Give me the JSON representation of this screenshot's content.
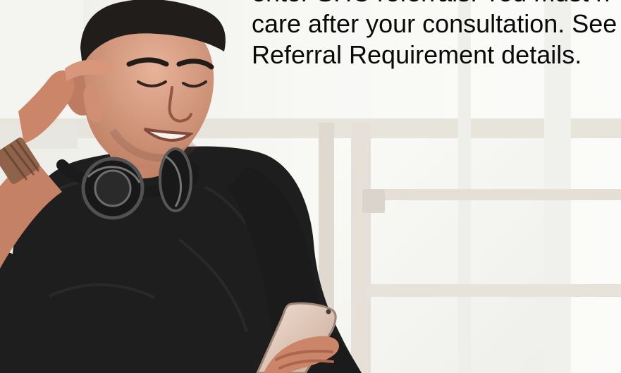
{
  "hero": {
    "caption_lines": [
      "enter SHC referrals. You must h",
      "care after your consultation. See",
      "Referral Requirement details."
    ]
  },
  "icons": {
    "hero_image": "young-man-headphones-smartphone-photo"
  },
  "colors": {
    "text": "#0a0a0a",
    "window_light": "#f3f3ef",
    "frame": "#e2ddd4",
    "sweater": "#151515",
    "skin": "#c98b6d"
  }
}
